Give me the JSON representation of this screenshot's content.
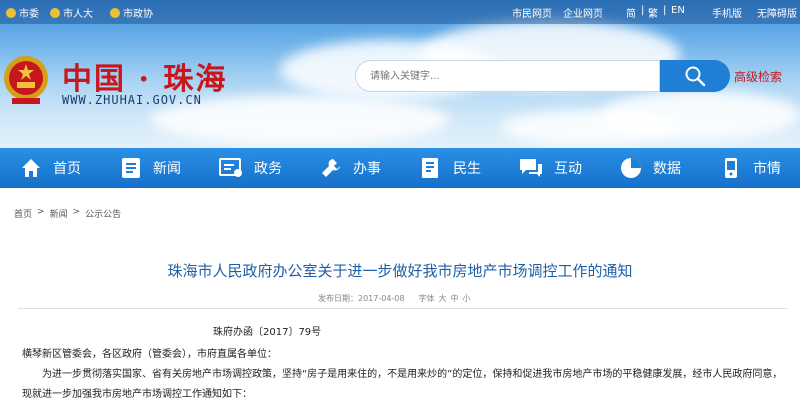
{
  "topbar": {
    "left_links": [
      "市委",
      "市人大",
      "市政协"
    ],
    "right_links": [
      "市民网页",
      "企业网页"
    ],
    "languages": [
      "简",
      "繁",
      "EN"
    ],
    "mobile": "手机版",
    "accessibility": "无障碍版"
  },
  "header": {
    "logo_text": "中国 · 珠海",
    "logo_url": "WWW.ZHUHAI.GOV.CN",
    "search_placeholder": "请输入关键字...",
    "advanced_search": "高级检索"
  },
  "nav": {
    "items": [
      {
        "label": "首页",
        "icon": "home-icon"
      },
      {
        "label": "新闻",
        "icon": "news-icon"
      },
      {
        "label": "政务",
        "icon": "government-affairs-icon"
      },
      {
        "label": "办事",
        "icon": "services-icon"
      },
      {
        "label": "民生",
        "icon": "livelihood-icon"
      },
      {
        "label": "互动",
        "icon": "interaction-icon"
      },
      {
        "label": "数据",
        "icon": "data-icon"
      },
      {
        "label": "市情",
        "icon": "city-info-icon"
      }
    ]
  },
  "breadcrumb": [
    "首页",
    "新闻",
    "公示公告"
  ],
  "article": {
    "title": "珠海市人民政府办公室关于进一步做好我市房地产市场调控工作的通知",
    "publish_date": "发布日期：2017-04-08",
    "font_size_label": "字体",
    "font_sizes": [
      "大",
      "中",
      "小"
    ],
    "doc_number": "珠府办函〔2017〕79号",
    "addressee": "横琴新区管委会，各区政府（管委会），市府直属各单位：",
    "paragraph": "为进一步贯彻落实国家、省有关房地产市场调控政策，坚持“房子是用来住的，不是用来炒的”的定位，保持和促进我市房地产市场的平稳健康发展，经市人民政府同意，现就进一步加强我市房地产市场调控工作通知如下："
  },
  "colors": {
    "nav_blue": "#1f7fd6",
    "title_blue": "#1f5fa8",
    "brand_red": "#c8161d"
  }
}
